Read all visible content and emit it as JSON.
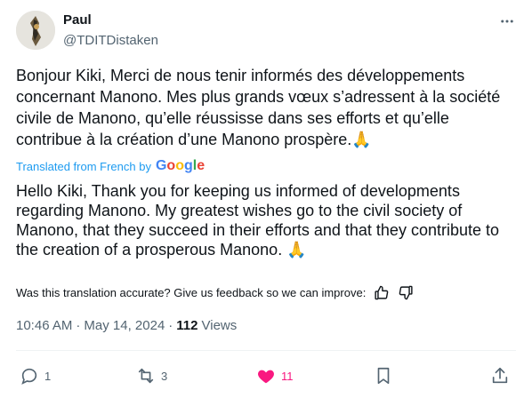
{
  "author": {
    "name": "Paul",
    "handle": "@TDITDistaken"
  },
  "tweet": {
    "original_text": "Bonjour Kiki, Merci de nous tenir informés des développements concernant Manono.  Mes plus grands vœux s’adressent à la société civile de Manono, qu’elle réussisse dans ses efforts et qu’elle contribue à la création d’une Manono prospère.🙏",
    "translated_from_label": "Translated from French by",
    "translator_logo": "Google",
    "translation_text": "Hello Kiki, Thank you for keeping us informed of developments regarding Manono. My greatest wishes go to the civil society of Manono, that they succeed in their efforts and that they contribute to the creation of a prosperous Manono. 🙏",
    "feedback_prompt": "Was this translation accurate? Give us feedback so we can improve:",
    "time": "10:46 AM",
    "date": "May 14, 2024",
    "views_count": "112",
    "views_label": "Views"
  },
  "actions": {
    "replies": "1",
    "reposts": "3",
    "likes": "11"
  },
  "icons": {
    "more": "more-horizontal-icon",
    "reply": "reply-bubble-icon",
    "repost": "repost-arrows-icon",
    "like": "heart-icon",
    "bookmark": "bookmark-icon",
    "share": "share-upload-icon",
    "thumbs_up": "thumbs-up-icon",
    "thumbs_down": "thumbs-down-icon"
  },
  "colors": {
    "text": "#0f1419",
    "secondary": "#536471",
    "link": "#1d9bf0",
    "like": "#f91880"
  }
}
